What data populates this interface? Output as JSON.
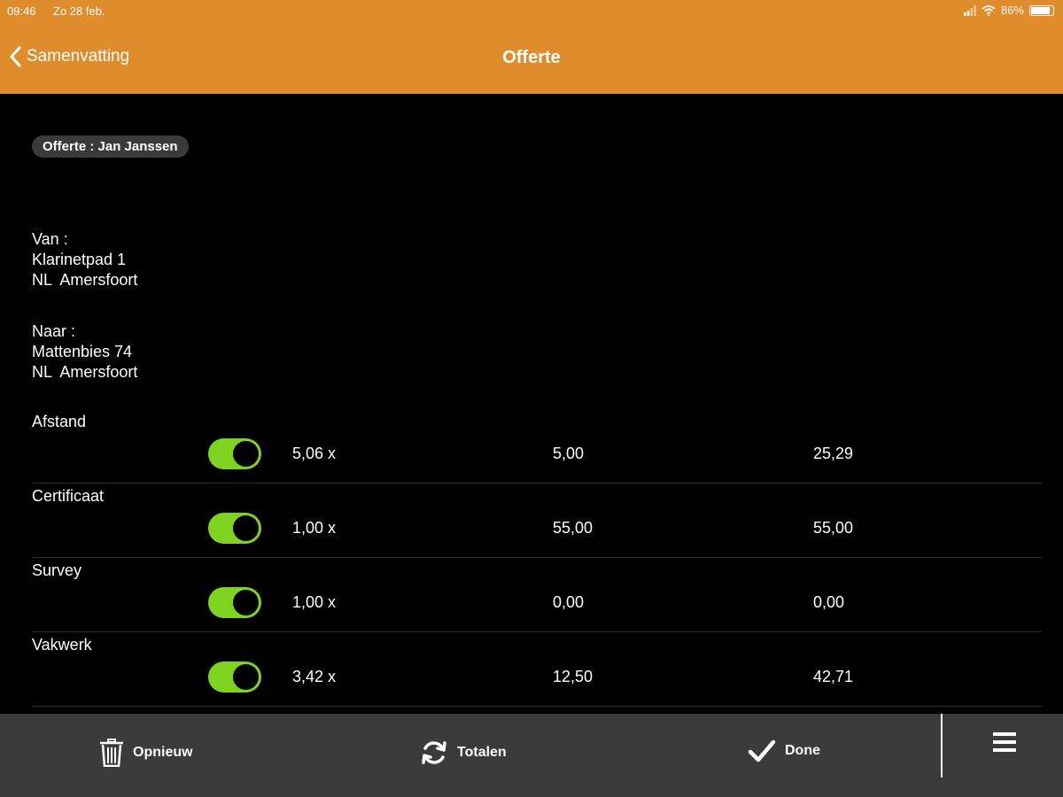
{
  "status_bar": {
    "time": "09:46",
    "date": "Zo 28 feb.",
    "battery": "86%",
    "battery_level": 0.86
  },
  "header": {
    "back_label": "Samenvatting",
    "title": "Offerte"
  },
  "quote": {
    "label": "Offerte : Jan Janssen"
  },
  "from": {
    "label": "Van :",
    "street": "Klarinetpad 1",
    "city": "NL  Amersfoort"
  },
  "to": {
    "label": "Naar :",
    "street": "Mattenbies 74",
    "city": "NL  Amersfoort"
  },
  "items": [
    {
      "label": "Afstand",
      "enabled": true,
      "qty": "5,06 x",
      "price": "5,00",
      "total": "25,29"
    },
    {
      "label": "Certificaat",
      "enabled": true,
      "qty": "1,00 x",
      "price": "55,00",
      "total": "55,00"
    },
    {
      "label": "Survey",
      "enabled": true,
      "qty": "1,00 x",
      "price": "0,00",
      "total": "0,00"
    },
    {
      "label": "Vakwerk",
      "enabled": true,
      "qty": "3,42 x",
      "price": "12,50",
      "total": "42,71"
    }
  ],
  "footer": {
    "reset_label": "Opnieuw",
    "totals_label": "Totalen",
    "done_label": "Done"
  },
  "colors": {
    "header": "#de8c2c",
    "toggle_on": "#7ed321",
    "footer": "#3b3b3b"
  },
  "icons": {
    "back": "chevron-left-icon",
    "wifi": "wifi-icon",
    "signal": "signal-icon",
    "reset": "trash-icon",
    "totals": "refresh-icon",
    "done": "checkmark-icon",
    "menu": "hamburger-menu-icon"
  }
}
